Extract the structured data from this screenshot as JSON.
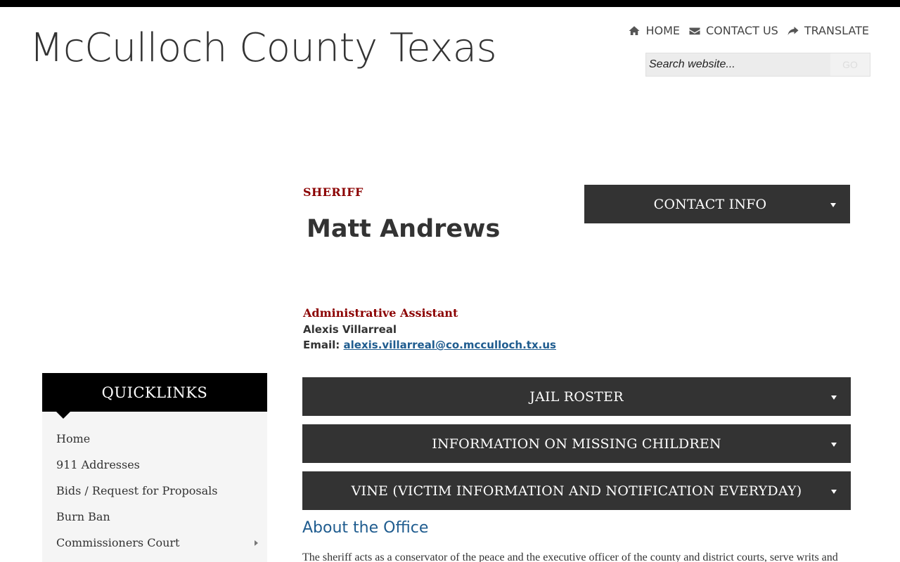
{
  "site": {
    "title": "McCulloch County Texas"
  },
  "topnav": [
    {
      "label": "HOME",
      "icon": "home-icon"
    },
    {
      "label": "CONTACT US",
      "icon": "envelope-icon"
    },
    {
      "label": "TRANSLATE",
      "icon": "share-arrow-icon"
    }
  ],
  "search": {
    "placeholder": "Search website...",
    "button_label": "GO"
  },
  "department": {
    "label": "SHERIFF",
    "name": "Matt Andrews"
  },
  "contact_info": {
    "label": "CONTACT INFO"
  },
  "assistant": {
    "role": "Administrative Assistant",
    "name": "Alexis Villarreal",
    "email_label": "Email:",
    "email": "alexis.villarreal@co.mcculloch.tx.us"
  },
  "accordions": [
    {
      "label": "JAIL ROSTER"
    },
    {
      "label": "INFORMATION ON MISSING CHILDREN"
    },
    {
      "label": "VINE (VICTIM INFORMATION AND NOTIFICATION EVERYDAY)"
    }
  ],
  "about": {
    "heading": "About the Office",
    "text": "The sheriff acts as a conservator of the peace and the executive officer of the county and district courts, serve writs and"
  },
  "quicklinks": {
    "title": "QUICKLINKS",
    "items": [
      {
        "label": "Home"
      },
      {
        "label": "911 Addresses"
      },
      {
        "label": "Bids / Request for Proposals"
      },
      {
        "label": "Burn Ban"
      },
      {
        "label": "Commissioners Court"
      }
    ]
  },
  "colors": {
    "accent_red": "#8b0000",
    "link_blue": "#1f5c8f",
    "panel_dark": "#333333"
  }
}
